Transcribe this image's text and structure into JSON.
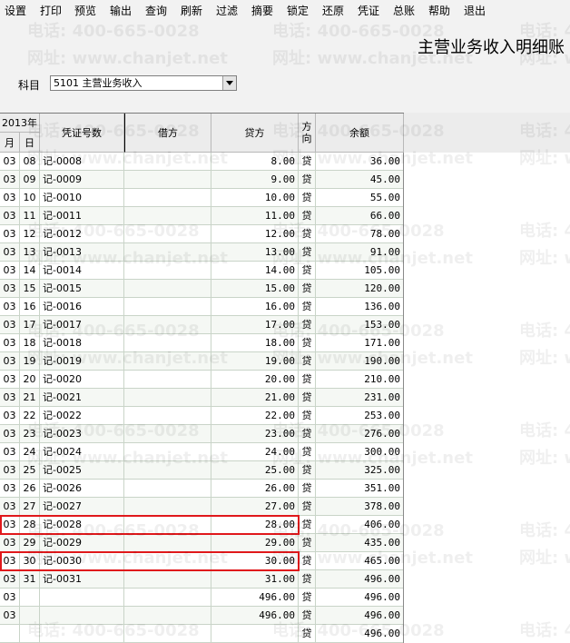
{
  "menu": [
    "设置",
    "打印",
    "预览",
    "输出",
    "查询",
    "刷新",
    "过滤",
    "摘要",
    "锁定",
    "还原",
    "凭证",
    "总账",
    "帮助",
    "退出"
  ],
  "title": "主营业务收入明细账",
  "subject": {
    "label": "科目",
    "value": "5101 主营业务收入"
  },
  "columns": {
    "year": "2013年",
    "month": "月",
    "day": "日",
    "voucher": "凭证号数",
    "debit": "借方",
    "credit": "贷方",
    "direction": "方向",
    "balance": "余额"
  },
  "rows": [
    {
      "m": "03",
      "d": "08",
      "v": "记-0008",
      "debit": "",
      "credit": "8.00",
      "dir": "贷",
      "bal": "36.00"
    },
    {
      "m": "03",
      "d": "09",
      "v": "记-0009",
      "debit": "",
      "credit": "9.00",
      "dir": "贷",
      "bal": "45.00"
    },
    {
      "m": "03",
      "d": "10",
      "v": "记-0010",
      "debit": "",
      "credit": "10.00",
      "dir": "贷",
      "bal": "55.00"
    },
    {
      "m": "03",
      "d": "11",
      "v": "记-0011",
      "debit": "",
      "credit": "11.00",
      "dir": "贷",
      "bal": "66.00"
    },
    {
      "m": "03",
      "d": "12",
      "v": "记-0012",
      "debit": "",
      "credit": "12.00",
      "dir": "贷",
      "bal": "78.00"
    },
    {
      "m": "03",
      "d": "13",
      "v": "记-0013",
      "debit": "",
      "credit": "13.00",
      "dir": "贷",
      "bal": "91.00"
    },
    {
      "m": "03",
      "d": "14",
      "v": "记-0014",
      "debit": "",
      "credit": "14.00",
      "dir": "贷",
      "bal": "105.00"
    },
    {
      "m": "03",
      "d": "15",
      "v": "记-0015",
      "debit": "",
      "credit": "15.00",
      "dir": "贷",
      "bal": "120.00"
    },
    {
      "m": "03",
      "d": "16",
      "v": "记-0016",
      "debit": "",
      "credit": "16.00",
      "dir": "贷",
      "bal": "136.00"
    },
    {
      "m": "03",
      "d": "17",
      "v": "记-0017",
      "debit": "",
      "credit": "17.00",
      "dir": "贷",
      "bal": "153.00"
    },
    {
      "m": "03",
      "d": "18",
      "v": "记-0018",
      "debit": "",
      "credit": "18.00",
      "dir": "贷",
      "bal": "171.00"
    },
    {
      "m": "03",
      "d": "19",
      "v": "记-0019",
      "debit": "",
      "credit": "19.00",
      "dir": "贷",
      "bal": "190.00"
    },
    {
      "m": "03",
      "d": "20",
      "v": "记-0020",
      "debit": "",
      "credit": "20.00",
      "dir": "贷",
      "bal": "210.00"
    },
    {
      "m": "03",
      "d": "21",
      "v": "记-0021",
      "debit": "",
      "credit": "21.00",
      "dir": "贷",
      "bal": "231.00"
    },
    {
      "m": "03",
      "d": "22",
      "v": "记-0022",
      "debit": "",
      "credit": "22.00",
      "dir": "贷",
      "bal": "253.00"
    },
    {
      "m": "03",
      "d": "23",
      "v": "记-0023",
      "debit": "",
      "credit": "23.00",
      "dir": "贷",
      "bal": "276.00"
    },
    {
      "m": "03",
      "d": "24",
      "v": "记-0024",
      "debit": "",
      "credit": "24.00",
      "dir": "贷",
      "bal": "300.00"
    },
    {
      "m": "03",
      "d": "25",
      "v": "记-0025",
      "debit": "",
      "credit": "25.00",
      "dir": "贷",
      "bal": "325.00"
    },
    {
      "m": "03",
      "d": "26",
      "v": "记-0026",
      "debit": "",
      "credit": "26.00",
      "dir": "贷",
      "bal": "351.00"
    },
    {
      "m": "03",
      "d": "27",
      "v": "记-0027",
      "debit": "",
      "credit": "27.00",
      "dir": "贷",
      "bal": "378.00"
    },
    {
      "m": "03",
      "d": "28",
      "v": "记-0028",
      "debit": "",
      "credit": "28.00",
      "dir": "贷",
      "bal": "406.00",
      "highlight": true
    },
    {
      "m": "03",
      "d": "29",
      "v": "记-0029",
      "debit": "",
      "credit": "29.00",
      "dir": "贷",
      "bal": "435.00"
    },
    {
      "m": "03",
      "d": "30",
      "v": "记-0030",
      "debit": "",
      "credit": "30.00",
      "dir": "贷",
      "bal": "465.00",
      "highlight": true
    },
    {
      "m": "03",
      "d": "31",
      "v": "记-0031",
      "debit": "",
      "credit": "31.00",
      "dir": "贷",
      "bal": "496.00"
    },
    {
      "m": "03",
      "d": "",
      "v": "",
      "debit": "",
      "credit": "496.00",
      "dir": "贷",
      "bal": "496.00"
    },
    {
      "m": "03",
      "d": "",
      "v": "",
      "debit": "",
      "credit": "496.00",
      "dir": "贷",
      "bal": "496.00"
    },
    {
      "m": "",
      "d": "",
      "v": "",
      "debit": "",
      "credit": "",
      "dir": "贷",
      "bal": "496.00"
    }
  ],
  "watermark": {
    "phone": "电话: 400-665-0028",
    "site": "网址: www.chanjet.net"
  },
  "colors": {
    "highlight": "#e0181b",
    "toolbar_bg": "#f2f2f2"
  }
}
